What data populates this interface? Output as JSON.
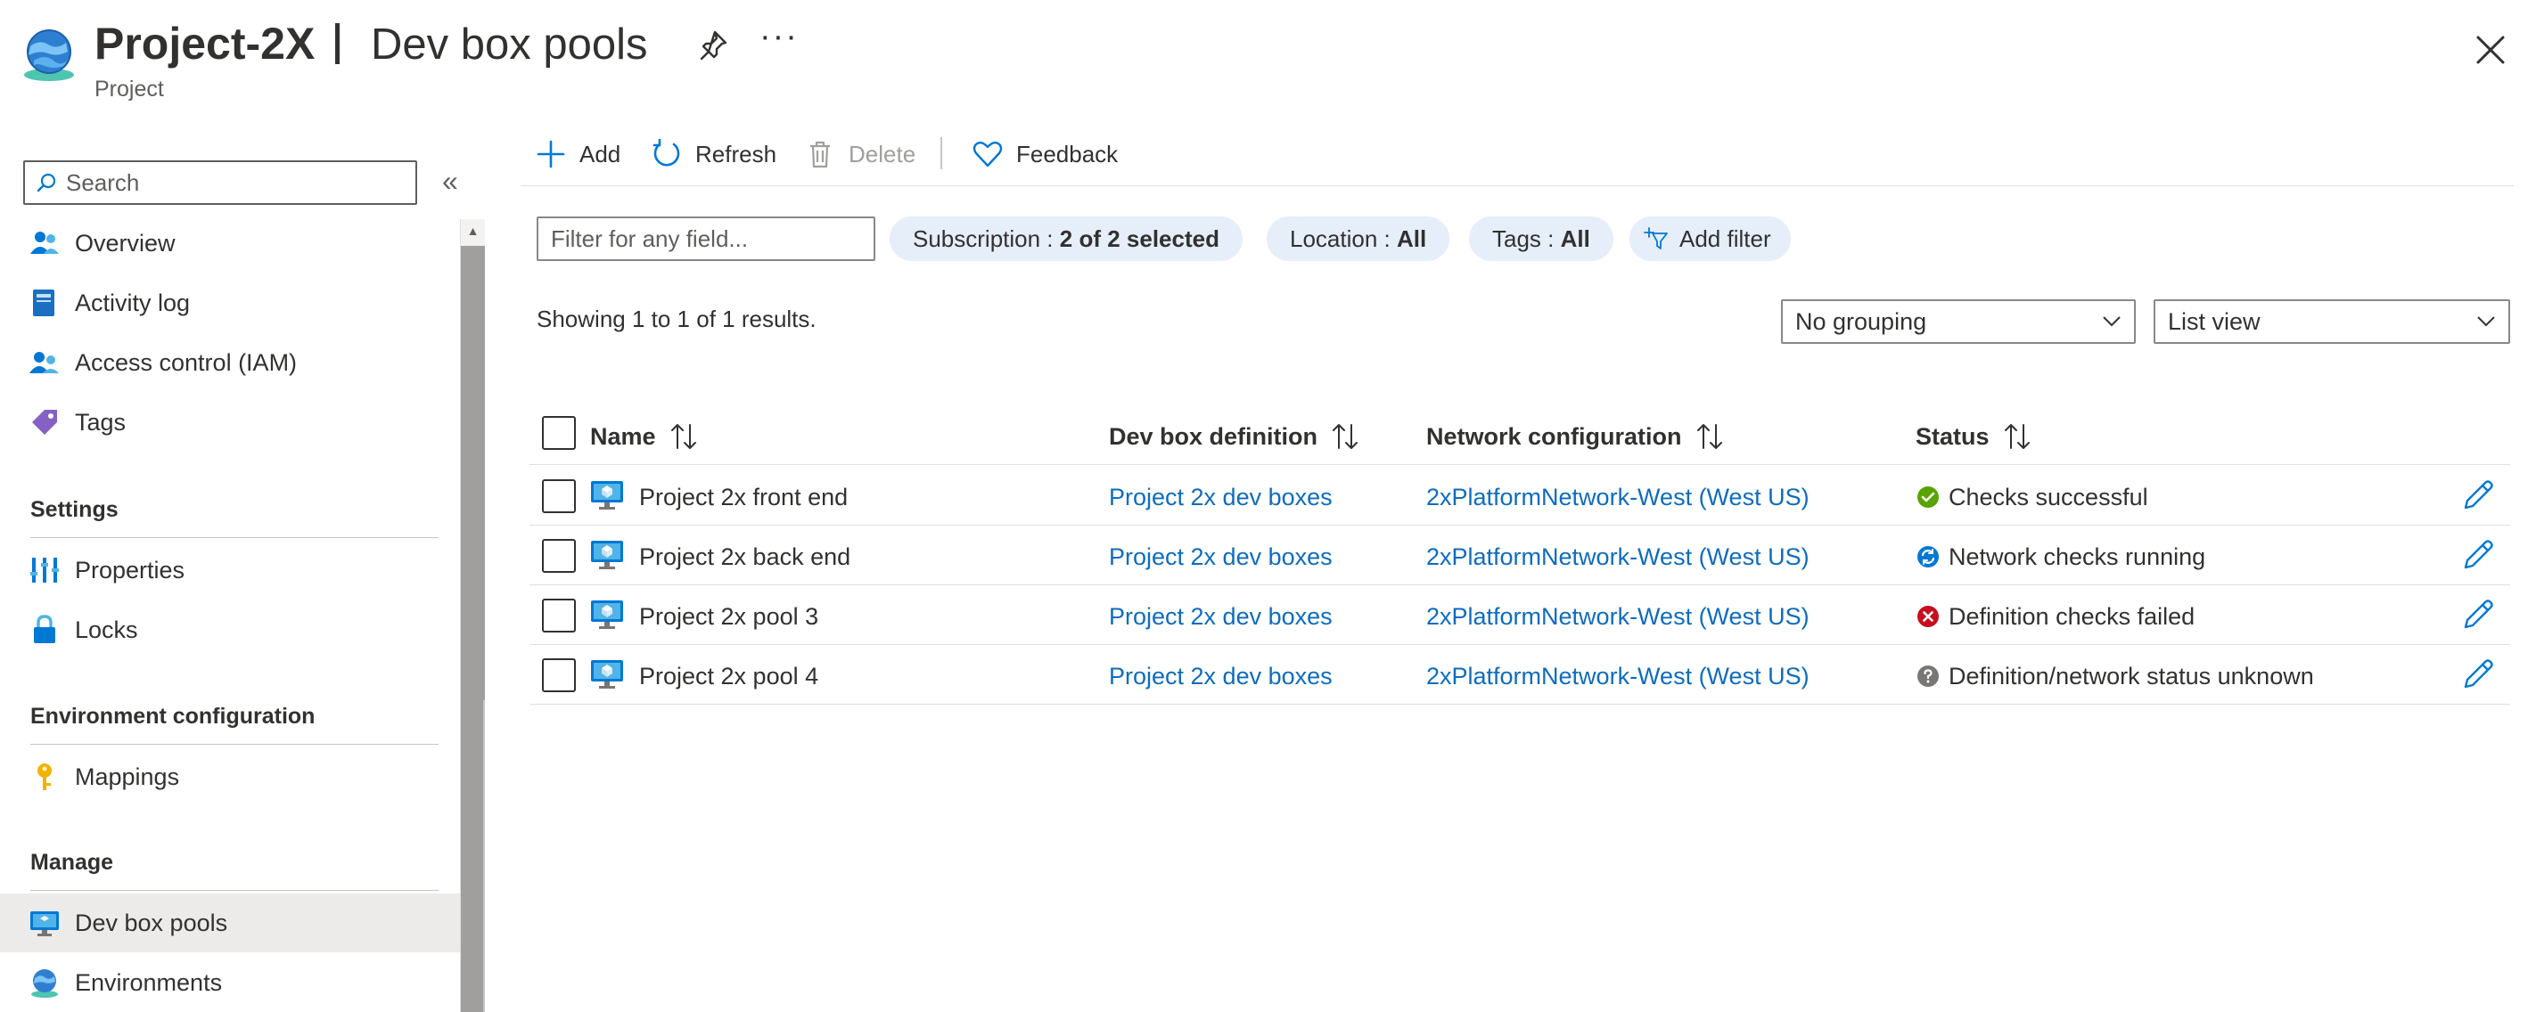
{
  "header": {
    "resource_name": "Project-2X",
    "page_title": "Dev box pools",
    "resource_type": "Project",
    "more_label": "···"
  },
  "sidebar": {
    "search_placeholder": "Search",
    "collapse_glyph": "«",
    "items": [
      {
        "label": "Overview",
        "icon": "people-icon"
      },
      {
        "label": "Activity log",
        "icon": "activity-log-icon"
      },
      {
        "label": "Access control (IAM)",
        "icon": "access-control-icon"
      },
      {
        "label": "Tags",
        "icon": "tag-icon"
      }
    ],
    "settings": {
      "title": "Settings",
      "items": [
        {
          "label": "Properties",
          "icon": "properties-icon"
        },
        {
          "label": "Locks",
          "icon": "lock-icon"
        }
      ]
    },
    "environment": {
      "title": "Environment configuration",
      "items": [
        {
          "label": "Mappings",
          "icon": "key-icon"
        }
      ]
    },
    "manage": {
      "title": "Manage",
      "items": [
        {
          "label": "Dev box pools",
          "icon": "dev-box-icon",
          "selected": true
        },
        {
          "label": "Environments",
          "icon": "environment-icon"
        }
      ]
    }
  },
  "toolbar": {
    "add": "Add",
    "refresh": "Refresh",
    "delete": "Delete",
    "feedback": "Feedback"
  },
  "filters": {
    "placeholder": "Filter for any field...",
    "subscription_key": "Subscription : ",
    "subscription_value": "2 of 2 selected",
    "location_key": "Location : ",
    "location_value": "All",
    "tags_key": "Tags : ",
    "tags_value": "All",
    "add_filter": "Add filter"
  },
  "results_text": "Showing 1 to 1 of 1 results.",
  "grouping": "No grouping",
  "view": "List view",
  "table": {
    "columns": [
      "Name",
      "Dev box definition",
      "Network configuration",
      "Status"
    ],
    "rows": [
      {
        "name": "Project 2x front end",
        "definition": "Project 2x dev boxes",
        "network": "2xPlatformNetwork-West (West US)",
        "status": "Checks successful",
        "status_kind": "success"
      },
      {
        "name": "Project 2x back end",
        "definition": "Project 2x dev boxes",
        "network": "2xPlatformNetwork-West (West US)",
        "status": "Network checks running",
        "status_kind": "running"
      },
      {
        "name": "Project 2x pool 3",
        "definition": "Project 2x dev boxes",
        "network": "2xPlatformNetwork-West (West US)",
        "status": "Definition checks failed",
        "status_kind": "failed"
      },
      {
        "name": "Project 2x pool 4",
        "definition": "Project 2x dev boxes",
        "network": "2xPlatformNetwork-West (West US)",
        "status": "Definition/network status unknown",
        "status_kind": "unknown"
      }
    ]
  },
  "colors": {
    "link": "#0f6cbd",
    "success": "#57a300",
    "running": "#0078d4",
    "failed": "#c50f1f",
    "unknown": "#797775",
    "pill_bg": "#e5eef9",
    "selected_nav": "#edebe9"
  }
}
